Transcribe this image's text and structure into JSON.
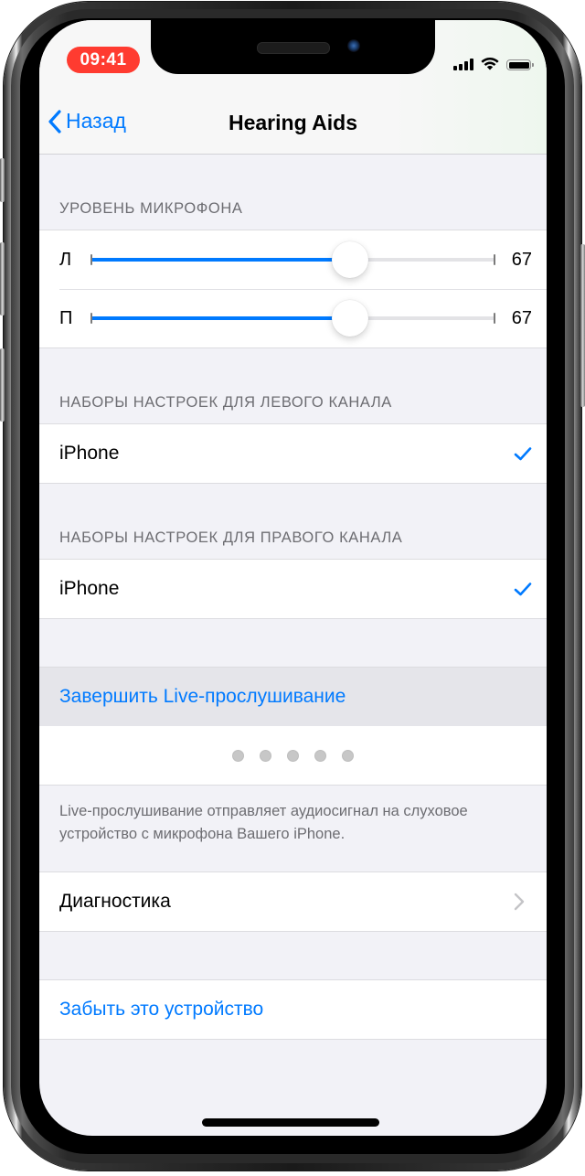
{
  "status_bar": {
    "time": "09:41",
    "icons": [
      "cellular-signal-icon",
      "wifi-icon",
      "battery-icon"
    ]
  },
  "nav": {
    "back_label": "Назад",
    "back_icon": "chevron-left-icon",
    "title": "Hearing Aids"
  },
  "mic_level": {
    "header": "УРОВЕНЬ МИКРОФОНА",
    "sliders": [
      {
        "label": "Л",
        "value": "67",
        "fraction": 0.64
      },
      {
        "label": "П",
        "value": "67",
        "fraction": 0.64
      }
    ]
  },
  "left_presets": {
    "header": "НАБОРЫ НАСТРОЕК ДЛЯ ЛЕВОГО КАНАЛА",
    "items": [
      {
        "label": "iPhone",
        "selected": true
      }
    ]
  },
  "right_presets": {
    "header": "НАБОРЫ НАСТРОЕК ДЛЯ ПРАВОГО КАНАЛА",
    "items": [
      {
        "label": "iPhone",
        "selected": true
      }
    ]
  },
  "live_listen": {
    "action_label": "Завершить Live-прослушивание",
    "level_dots": 5,
    "footer": "Live-прослушивание отправляет аудиосигнал на слуховое устройство с микрофона Вашего iPhone."
  },
  "diagnostics": {
    "label": "Диагностика"
  },
  "forget": {
    "label": "Забыть это устройство"
  },
  "colors": {
    "accent": "#007AFF",
    "time_pill": "#FF3B30",
    "background": "#F2F2F7",
    "highlight": "#E5E5EA"
  }
}
